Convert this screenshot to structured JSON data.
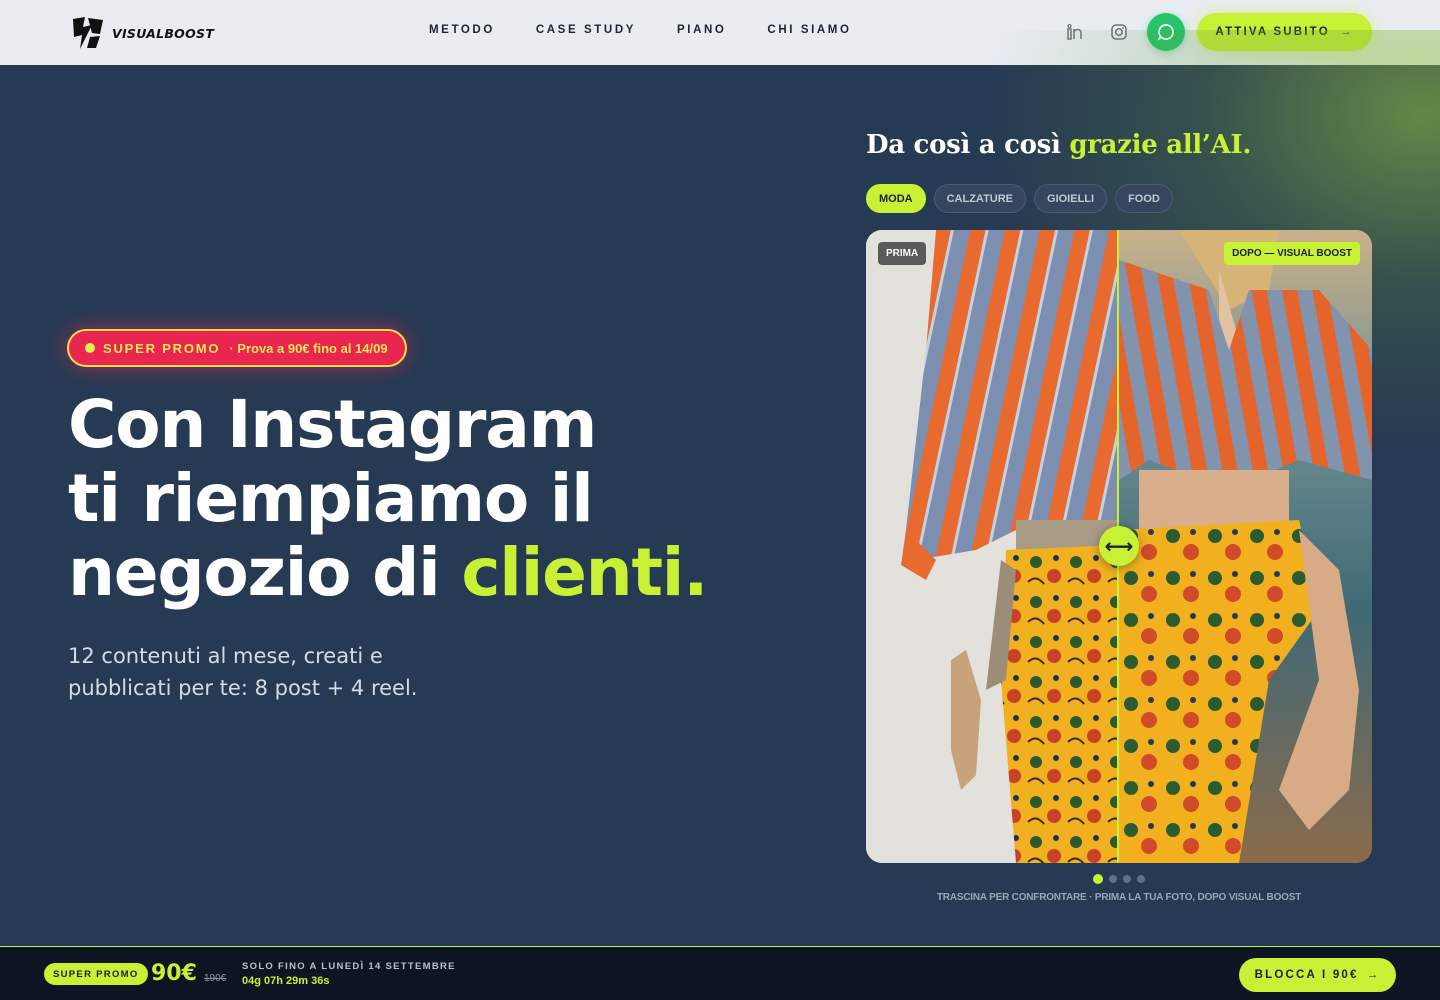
{
  "brand": {
    "name": "VISUALBOOST"
  },
  "nav": {
    "items": [
      "METODO",
      "CASE STUDY",
      "PIANO",
      "CHI SIAMO"
    ],
    "social": [
      "linkedin-icon",
      "instagram-icon"
    ],
    "whatsapp_icon": "whatsapp-icon",
    "cta_label": "ATTIVA SUBITO"
  },
  "hero": {
    "promo": {
      "label": "SUPER PROMO",
      "detail": "· Prova a 90€ fino al 14/09"
    },
    "headline": {
      "line1": "Con Instagram",
      "line2": "ti riempiamo il",
      "line3_prefix": "negozio di ",
      "line3_accent": "clienti."
    },
    "subhead": "12 contenuti al mese, creati e pubblicati per te: 8 post + 4 reel."
  },
  "compare": {
    "title_prefix": "Da così a così ",
    "title_accent": "grazie all’AI.",
    "tabs": [
      "MODA",
      "CALZATURE",
      "GIOIELLI",
      "FOOD"
    ],
    "active_tab": "MODA",
    "tag_before": "PRIMA",
    "tag_after": "DOPO — VISUAL BOOST",
    "handle_symbol": "⟷",
    "slides": 4,
    "active_slide": 1,
    "caption": "TRASCINA PER CONFRONTARE · PRIMA LA TUA FOTO, DOPO VISUAL BOOST"
  },
  "bottom_bar": {
    "badge": "SUPER PROMO",
    "price": "90€",
    "old_price": "190€",
    "until": "SOLO FINO A LUNEDÌ 14 SETTEMBRE",
    "timer": "04g 07h 29m 36s",
    "cta_label": "BLOCCA I 90€"
  },
  "colors": {
    "accent": "#c8f135",
    "background": "#263a53",
    "nav_bg": "#e9edf2",
    "promo_red": "#e8264f",
    "whatsapp": "#25c46a"
  }
}
